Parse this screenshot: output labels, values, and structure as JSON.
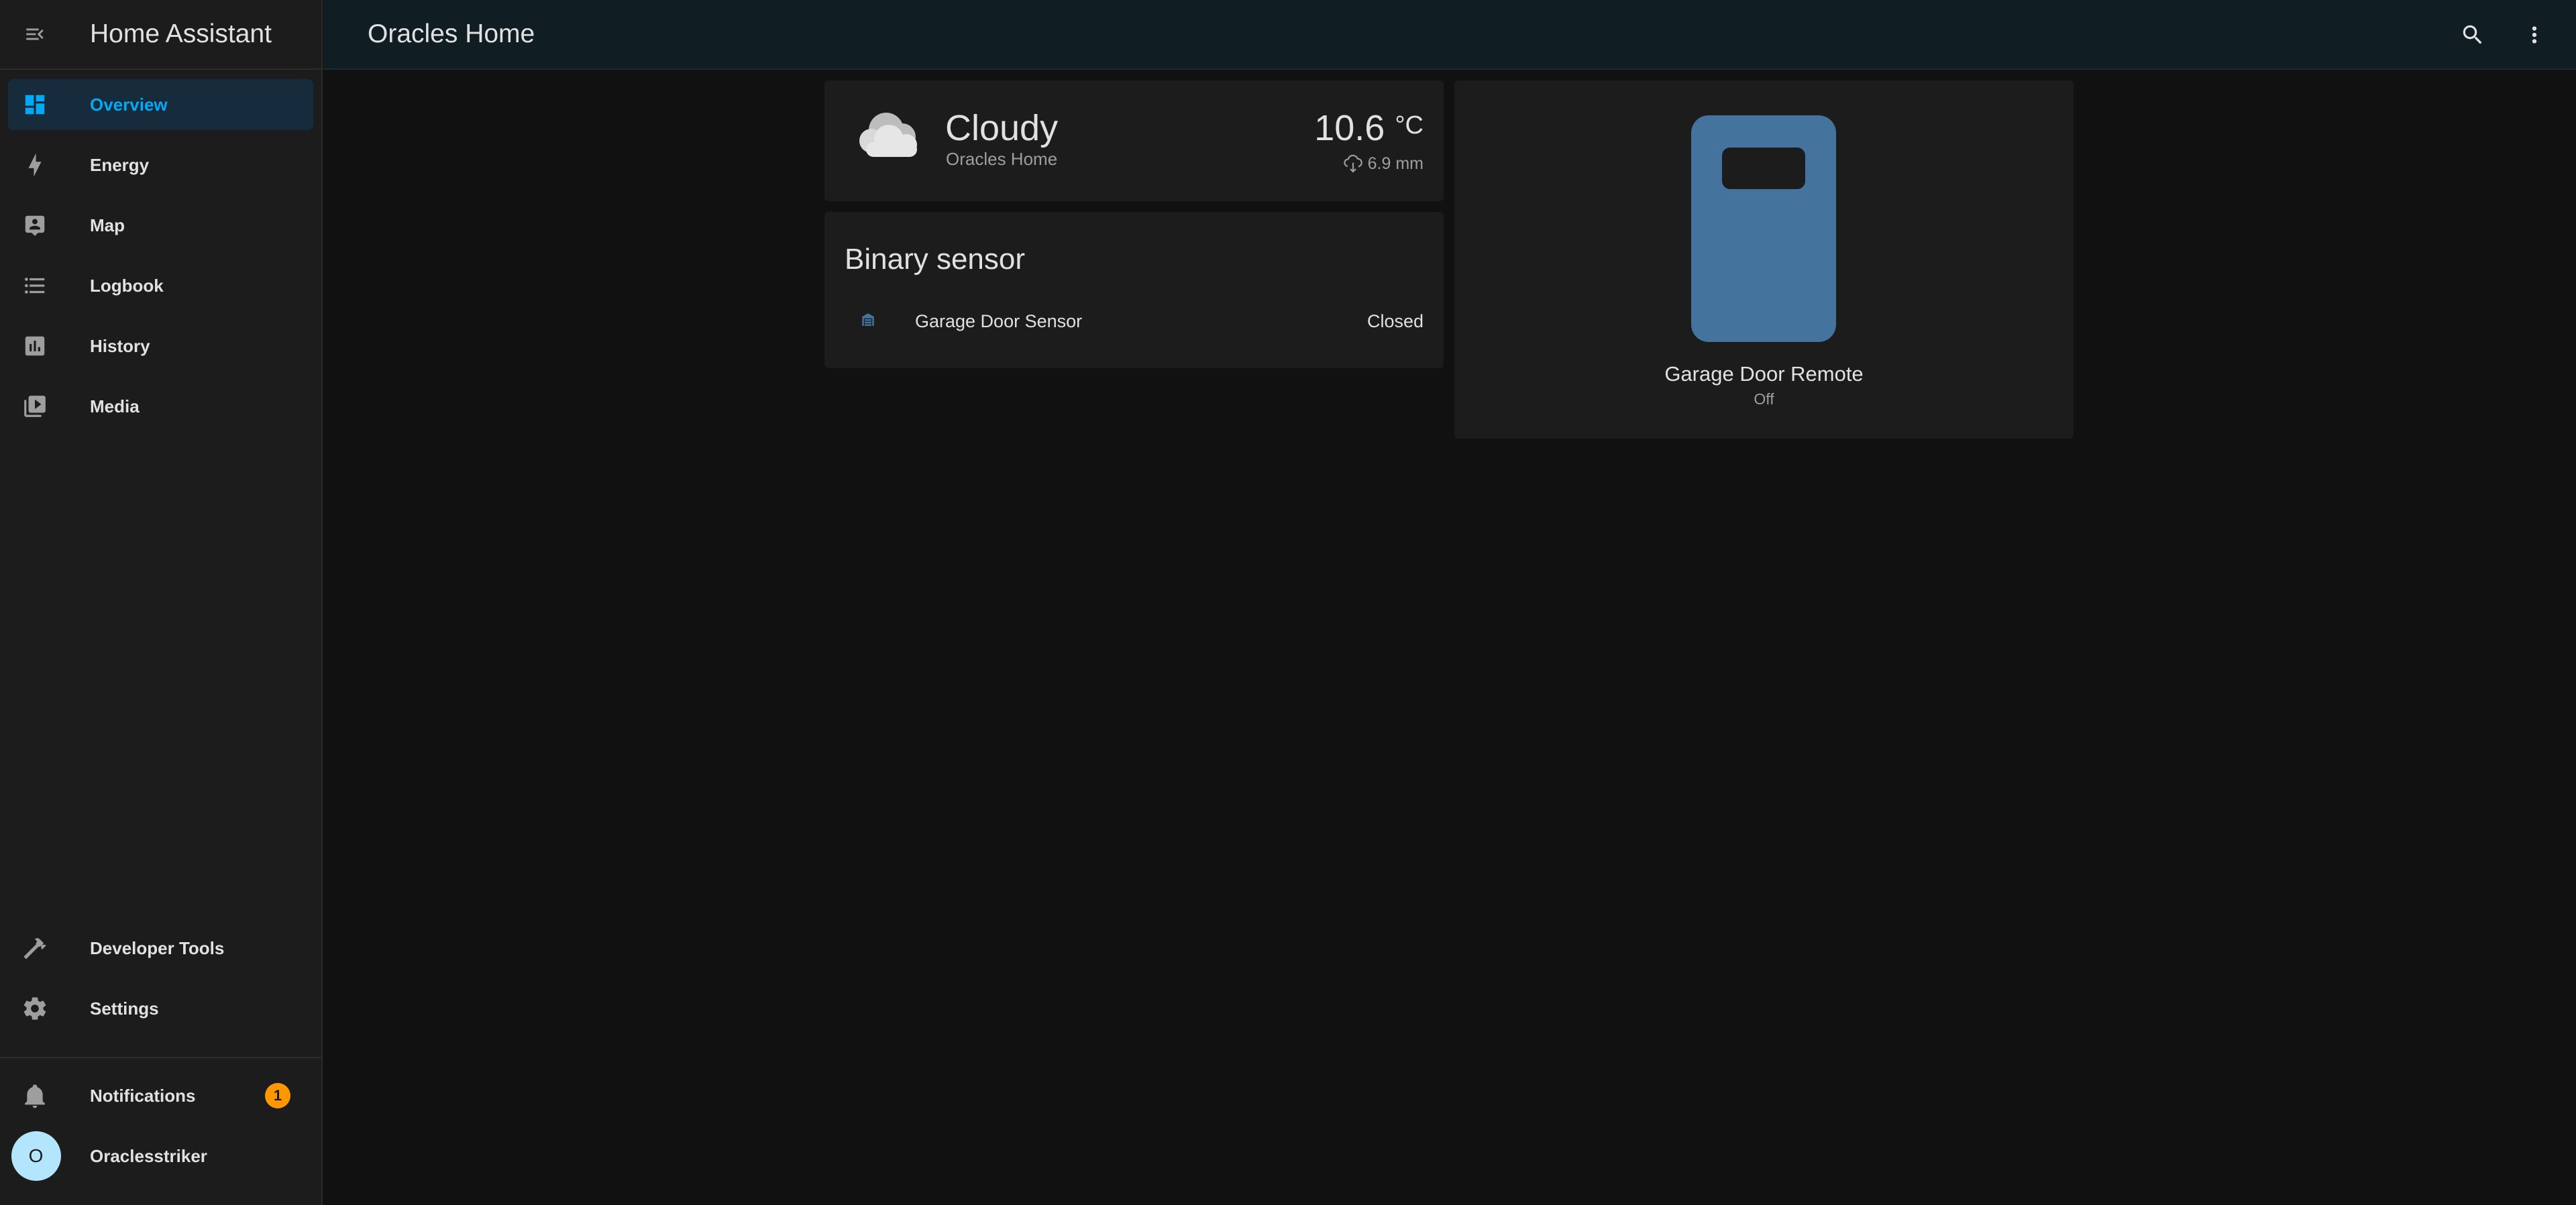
{
  "app": {
    "title": "Home Assistant"
  },
  "sidebar": {
    "items": [
      {
        "label": "Overview",
        "icon": "dashboard-icon",
        "active": true
      },
      {
        "label": "Energy",
        "icon": "lightning-bolt-icon"
      },
      {
        "label": "Map",
        "icon": "map-account-icon"
      },
      {
        "label": "Logbook",
        "icon": "format-list-bulleted-icon"
      },
      {
        "label": "History",
        "icon": "chart-box-icon"
      },
      {
        "label": "Media",
        "icon": "play-box-multiple-icon"
      }
    ],
    "bottom_items": [
      {
        "label": "Developer Tools",
        "icon": "hammer-icon"
      },
      {
        "label": "Settings",
        "icon": "cog-icon"
      }
    ],
    "notifications": {
      "label": "Notifications",
      "count": "1"
    },
    "user": {
      "name": "Oraclesstriker",
      "initial": "O"
    }
  },
  "header": {
    "title": "Oracles Home"
  },
  "weather": {
    "condition": "Cloudy",
    "location": "Oracles Home",
    "temperature": "10.6",
    "unit": "°C",
    "precipitation": "6.9 mm"
  },
  "binary_sensor": {
    "title": "Binary sensor",
    "entity": {
      "name": "Garage Door Sensor",
      "state": "Closed"
    }
  },
  "remote": {
    "name": "Garage Door Remote",
    "state": "Off"
  },
  "colors": {
    "accent": "#03a9f4",
    "active_bg": "#162b3b",
    "remote_blue": "#44739e",
    "badge": "#ff9800"
  }
}
